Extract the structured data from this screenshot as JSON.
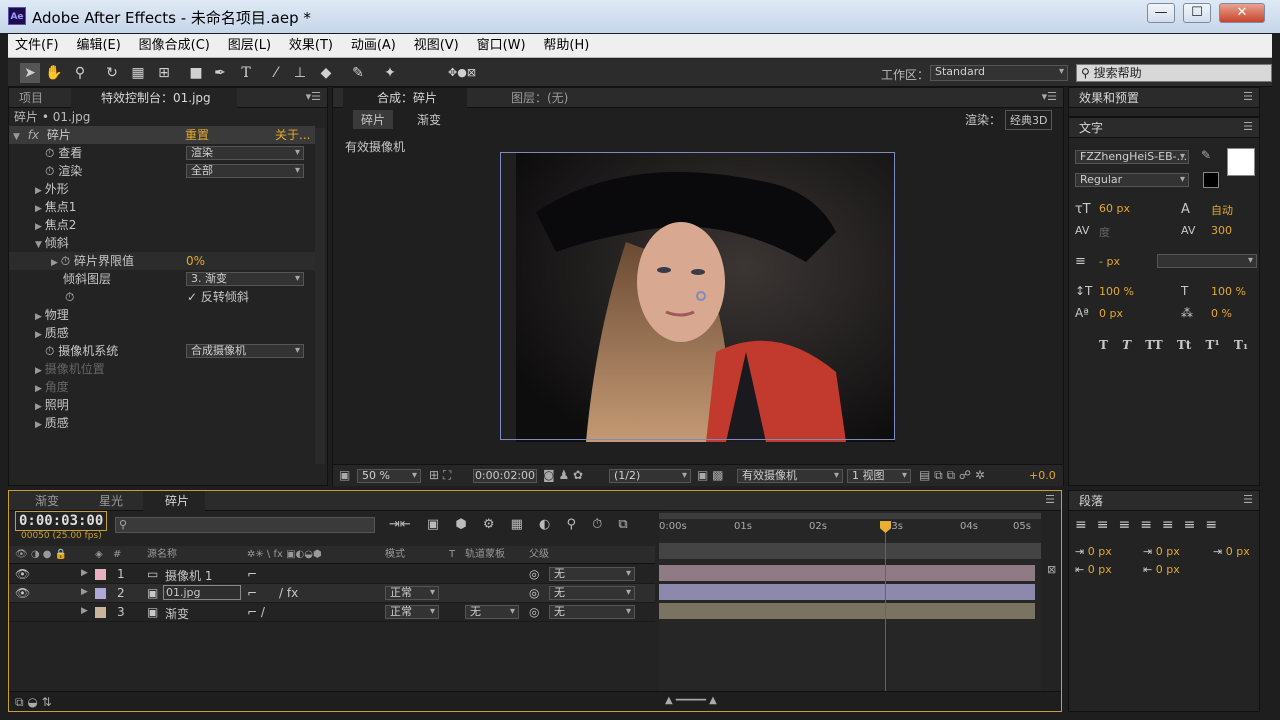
{
  "window": {
    "app_icon": "Ae",
    "title": "Adobe After Effects - 未命名项目.aep *",
    "minimize": "—",
    "maximize": "☐",
    "close": "✕"
  },
  "menu": [
    "文件(F)",
    "编辑(E)",
    "图像合成(C)",
    "图层(L)",
    "效果(T)",
    "动画(A)",
    "视图(V)",
    "窗口(W)",
    "帮助(H)"
  ],
  "toolbar": {
    "tools": [
      "selection-tool",
      "hand-tool",
      "zoom-tool",
      "rotate-tool",
      "camera-tool",
      "pan-behind-tool",
      "rectangle-tool",
      "pen-tool",
      "type-tool",
      "brush-tool",
      "clone-stamp-tool",
      "eraser-tool",
      "roto-brush-tool",
      "puppet-pin-tool"
    ],
    "workspace_label": "工作区：",
    "workspace_value": "Standard",
    "search_placeholder": "搜索帮助"
  },
  "effect_controls": {
    "tab_project": "项目",
    "tab_effects": "特效控制台：01.jpg",
    "breadcrumb": "碎片 • 01.jpg",
    "effect_name": "碎片",
    "reset": "重置",
    "about": "关于...",
    "properties": [
      {
        "label": "查看",
        "value": "渲染"
      },
      {
        "label": "渲染",
        "value": "全部"
      },
      {
        "label": "外形"
      },
      {
        "label": "焦点1"
      },
      {
        "label": "焦点2"
      },
      {
        "label": "倾斜"
      },
      {
        "label": "碎片界限值",
        "value": "0%"
      },
      {
        "label": "倾斜图层",
        "value": "3. 渐变"
      },
      {
        "label": "",
        "value": "反转倾斜"
      },
      {
        "label": "物理"
      },
      {
        "label": "质感"
      },
      {
        "label": "摄像机系统",
        "value": "合成摄像机"
      },
      {
        "label": "摄像机位置"
      },
      {
        "label": "角度"
      },
      {
        "label": "照明"
      },
      {
        "label": "质感"
      }
    ]
  },
  "composition": {
    "tab_label": "合成：碎片",
    "layer_tab": "图层：(无)",
    "breadcrumb_1": "碎片",
    "breadcrumb_2": "渐变",
    "render_label": "渲染：",
    "render_value": "经典3D",
    "camera_label": "有效摄像机",
    "zoom": "50 %",
    "timecode": "0:00:02:00",
    "resolution": "(1/2)",
    "active_camera": "有效摄像机",
    "views": "1 视图",
    "exposure": "+0.0"
  },
  "effects_presets": {
    "tab": "效果和预置"
  },
  "character": {
    "tab": "文字",
    "font": "FZZhengHeiS-EB-...",
    "style": "Regular",
    "size": "60 px",
    "leading": "自动",
    "kerning": "度",
    "tracking": "300",
    "stroke_width": "- px",
    "vscale": "100 %",
    "hscale": "100 %",
    "baseline": "0 px",
    "tsume": "0 %",
    "styles": [
      "T",
      "T",
      "TT",
      "Tt",
      "T¹",
      "T₁"
    ],
    "fill_color": "#ffffff"
  },
  "paragraph": {
    "tab": "段落",
    "indent_left": "0 px",
    "indent_right": "0 px",
    "indent_first": "0 px",
    "space_before": "0 px",
    "space_after": "0 px"
  },
  "timeline": {
    "tabs": [
      "渐变",
      "星光",
      "碎片"
    ],
    "timecode": "0:00:03:00",
    "frames": "00050 (25.00 fps)",
    "col_source": "源名称",
    "col_mode": "模式",
    "col_t": "T",
    "col_trkmat": "轨道蒙板",
    "col_parent": "父级",
    "ruler": [
      "0:00s",
      "01s",
      "02s",
      "03s",
      "04s",
      "05s"
    ],
    "playhead_time": 3.0,
    "duration": 5.0,
    "layers": [
      {
        "num": "1",
        "name": "摄像机 1",
        "mode": "",
        "trkmat": "",
        "parent": "无",
        "color": "#e8b0c0",
        "bar": "#8f7a86"
      },
      {
        "num": "2",
        "name": "01.jpg",
        "mode": "正常",
        "trkmat": "",
        "parent": "无",
        "color": "#b0a8d8",
        "bar": "#8d89ad"
      },
      {
        "num": "3",
        "name": "渐变",
        "mode": "正常",
        "trkmat": "无",
        "parent": "无",
        "color": "#c8b49a",
        "bar": "#7b7362"
      }
    ]
  }
}
